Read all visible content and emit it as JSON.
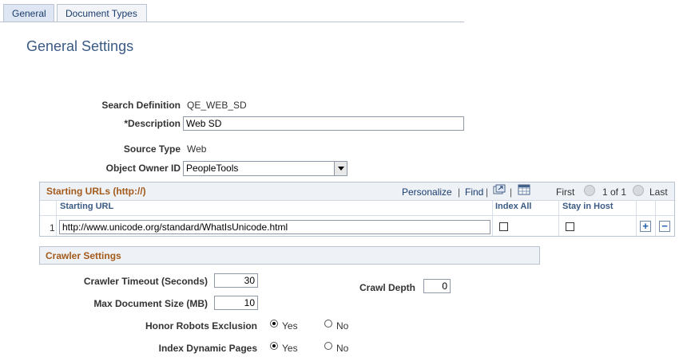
{
  "tabs": [
    {
      "label": "General",
      "active": true
    },
    {
      "label": "Document Types",
      "active": false
    }
  ],
  "page_title": "General Settings",
  "form": {
    "search_definition_label": "Search Definition",
    "search_definition_value": "QE_WEB_SD",
    "description_label": "*Description",
    "description_value": "Web SD",
    "source_type_label": "Source Type",
    "source_type_value": "Web",
    "object_owner_label": "Object Owner ID",
    "object_owner_value": "PeopleTools"
  },
  "starting_urls": {
    "title": "Starting URLs (http://)",
    "personalize": "Personalize",
    "sep": "|",
    "find": "Find",
    "first": "First",
    "pager": "1 of 1",
    "last": "Last",
    "columns": [
      "Starting URL",
      "Index All",
      "Stay in Host"
    ],
    "rows": [
      {
        "num": "1",
        "url": "http://www.unicode.org/standard/WhatIsUnicode.html",
        "index_all": false,
        "stay_in_host": false
      }
    ],
    "add_label": "+",
    "remove_label": "−"
  },
  "crawler": {
    "title": "Crawler Settings",
    "timeout_label": "Crawler Timeout (Seconds)",
    "timeout_value": "30",
    "max_doc_label": "Max Document Size (MB)",
    "max_doc_value": "10",
    "crawl_depth_label": "Crawl Depth",
    "crawl_depth_value": "0",
    "honor_robots_label": "Honor Robots Exclusion",
    "index_dynamic_label": "Index Dynamic Pages",
    "yes": "Yes",
    "no": "No",
    "honor_robots_selected": "Yes",
    "index_dynamic_selected": "Yes"
  },
  "colors": {
    "section_title": "#a35a1a",
    "link": "#1a3c6e",
    "page_title": "#3a5a84"
  }
}
